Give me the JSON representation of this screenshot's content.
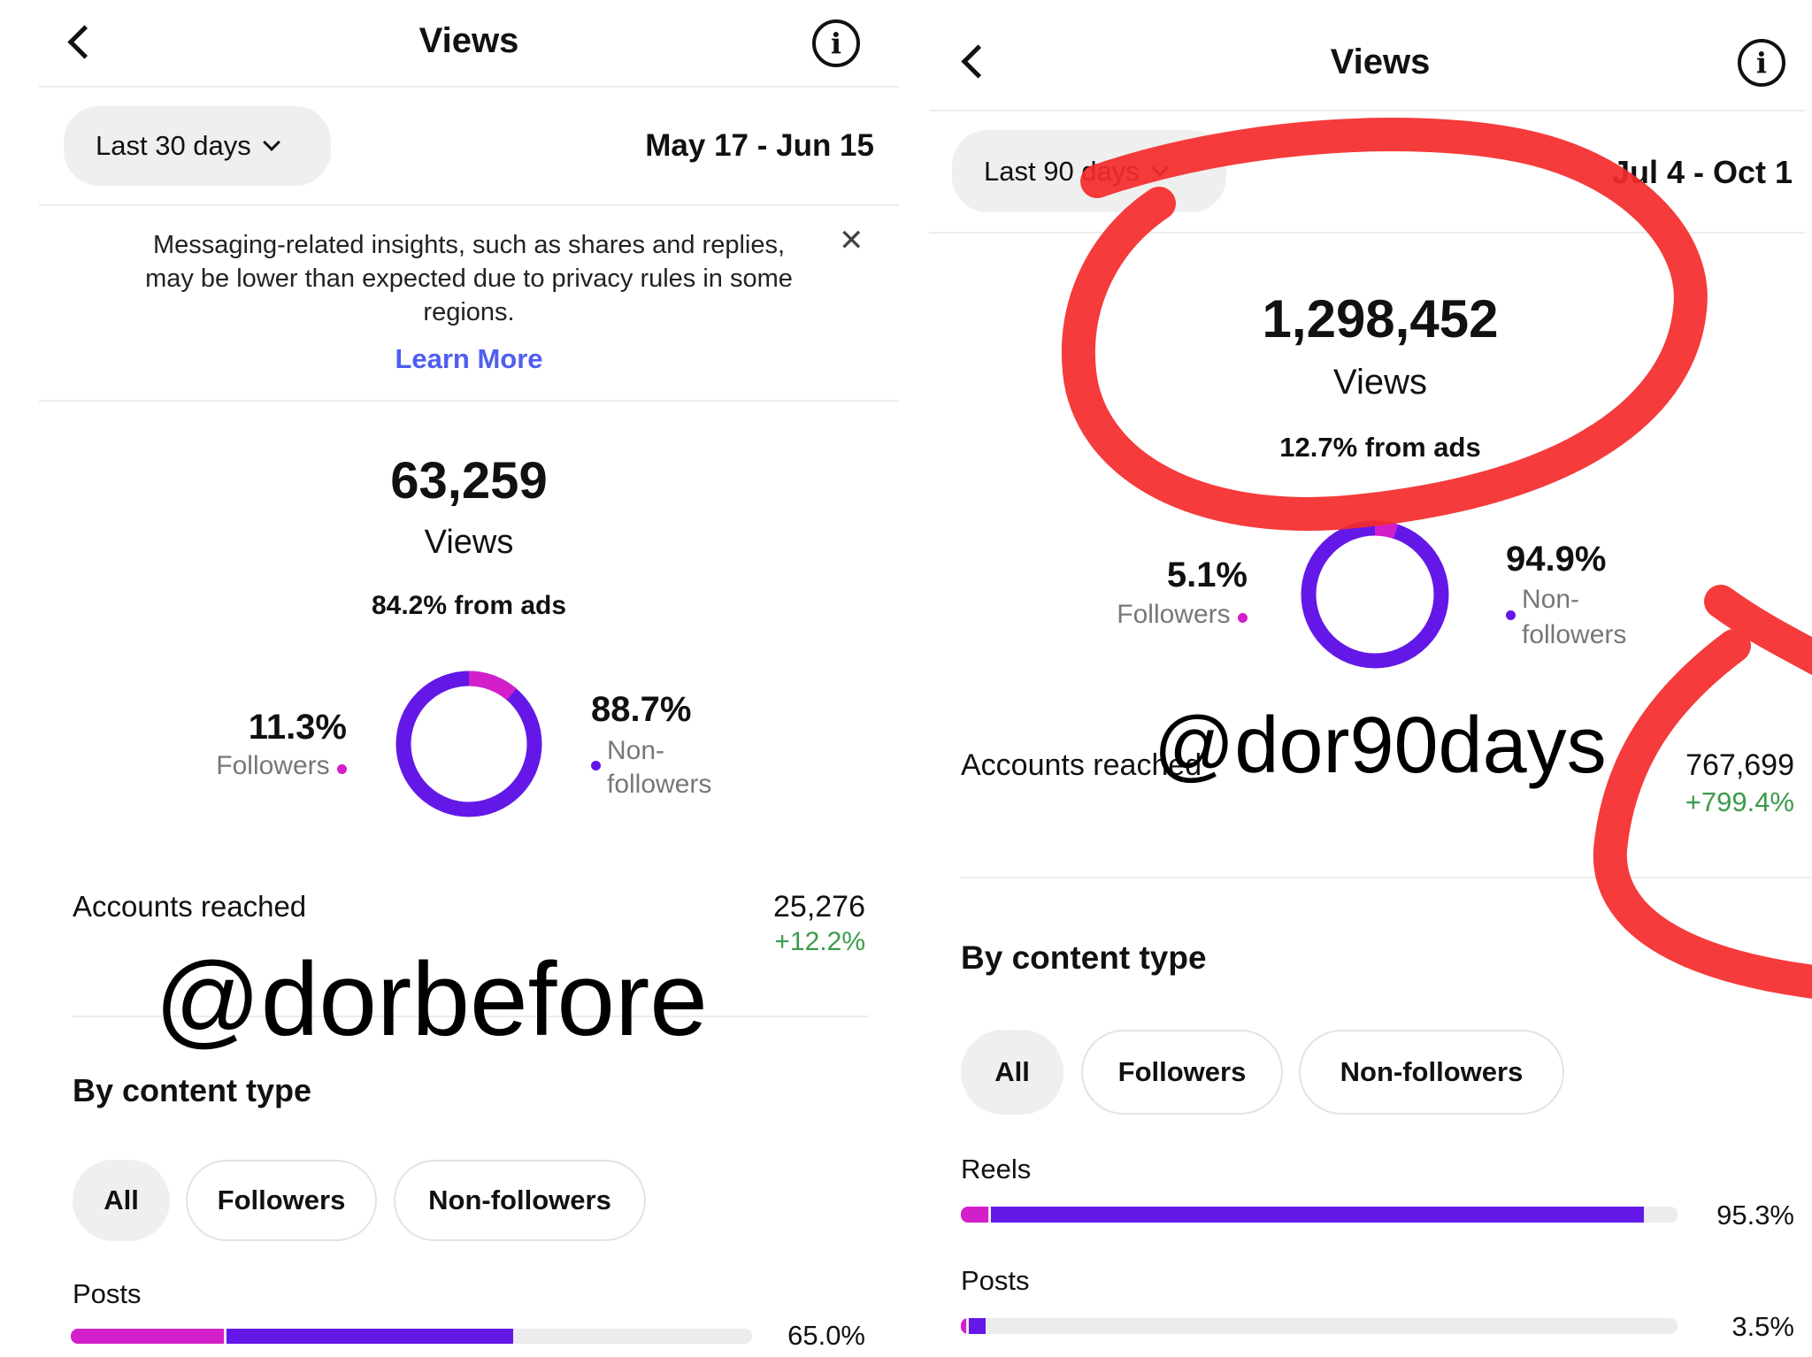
{
  "colors": {
    "follower": "#d21fc9",
    "nonfollower": "#6418e8",
    "accent_link": "#4f5ef0",
    "positive": "#3c9a4c",
    "annotation": "#f42a2a"
  },
  "left": {
    "header": {
      "title": "Views",
      "back_icon": "chevron-left-icon",
      "info_icon": "info-icon"
    },
    "range": {
      "label": "Last 30 days",
      "dates": "May 17 - Jun 15"
    },
    "notice": {
      "text": "Messaging-related insights, such as shares and replies, may be lower than expected due to privacy rules in some regions.",
      "link": "Learn More",
      "close_icon": "close-icon"
    },
    "summary": {
      "total": "63,259",
      "label": "Views",
      "ads": "84.2% from ads"
    },
    "split": {
      "followers": {
        "pct": "11.3%",
        "label": "Followers",
        "value": 11.3
      },
      "nonfollowers": {
        "pct": "88.7%",
        "label_line1": "Non-",
        "label_line2": "followers",
        "value": 88.7
      }
    },
    "reach": {
      "label": "Accounts reached",
      "value": "25,276",
      "change": "+12.2%"
    },
    "watermark": "@dorbefore",
    "content_type": {
      "heading": "By content type",
      "filters": [
        "All",
        "Followers",
        "Non-followers"
      ],
      "rows": [
        {
          "label": "Posts",
          "pct": "65.0%",
          "total": 65.0,
          "follower_share": 34.5
        }
      ]
    }
  },
  "right": {
    "header": {
      "title": "Views",
      "back_icon": "chevron-left-icon",
      "info_icon": "info-icon"
    },
    "range": {
      "label": "Last 90 days",
      "dates": "Jul 4 - Oct 1"
    },
    "summary": {
      "total": "1,298,452",
      "label": "Views",
      "ads": "12.7% from ads"
    },
    "split": {
      "followers": {
        "pct": "5.1%",
        "label": "Followers",
        "value": 5.1
      },
      "nonfollowers": {
        "pct": "94.9%",
        "label_line1": "Non-",
        "label_line2": "followers",
        "value": 94.9
      }
    },
    "reach": {
      "label": "Accounts reached",
      "value": "767,699",
      "change": "+799.4%"
    },
    "watermark": "@dor90days",
    "content_type": {
      "heading": "By content type",
      "filters": [
        "All",
        "Followers",
        "Non-followers"
      ],
      "rows": [
        {
          "label": "Reels",
          "pct": "95.3%",
          "total": 95.3,
          "follower_share": 4.0
        },
        {
          "label": "Posts",
          "pct": "3.5%",
          "total": 3.5,
          "follower_share": 20
        }
      ]
    }
  }
}
